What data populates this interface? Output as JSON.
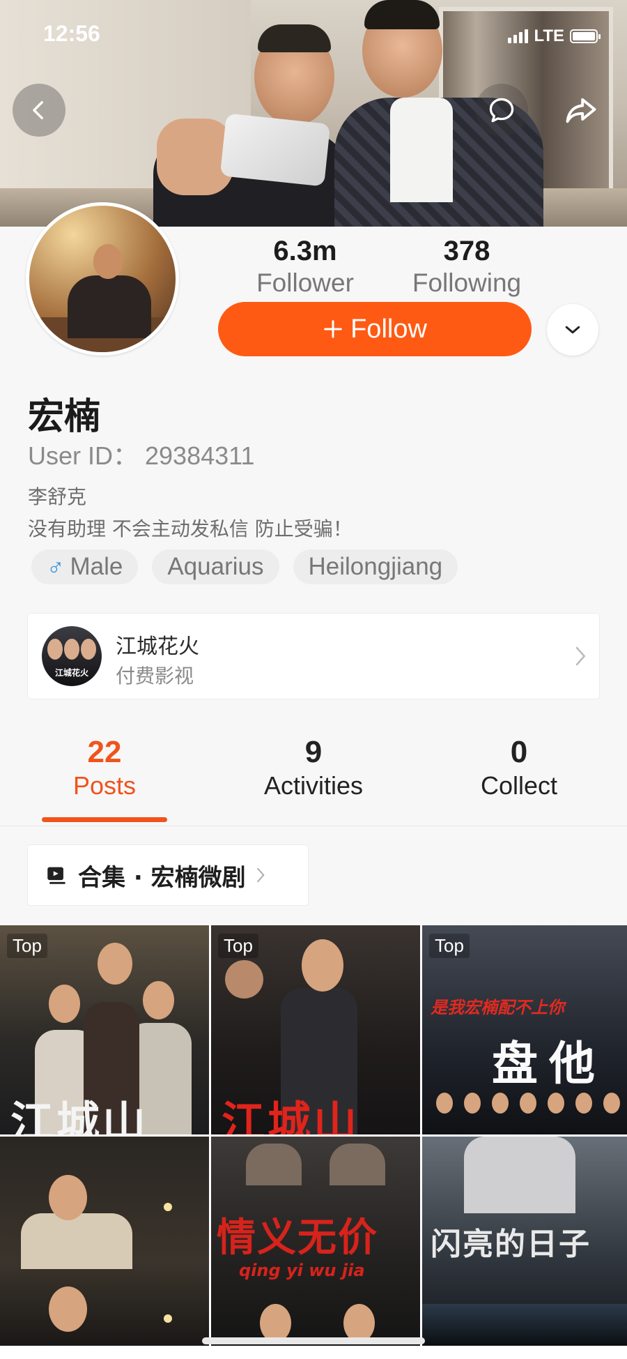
{
  "status_bar": {
    "time": "12:56",
    "network": "LTE"
  },
  "header": {
    "back_icon": "chevron-left-icon",
    "comment_icon": "comment-icon",
    "share_icon": "share-icon"
  },
  "profile": {
    "followers": "6.3m",
    "followers_label": "Follower",
    "following": "378",
    "following_label": "Following",
    "follow_button": "Follow",
    "name": "宏楠",
    "user_id": "User ID： 29384311",
    "bio_line1": "李舒克",
    "bio_line2": "没有助理 不会主动发私信 防止受骗！",
    "tags": [
      {
        "label": "Male",
        "icon": "male-icon"
      },
      {
        "label": "Aquarius"
      },
      {
        "label": "Heilongjiang"
      }
    ]
  },
  "drama_card": {
    "title": "江城花火",
    "subtitle": "付费影视",
    "thumb_text": "江城花火"
  },
  "tabs": [
    {
      "count": "22",
      "label": "Posts",
      "active": true
    },
    {
      "count": "9",
      "label": "Activities",
      "active": false
    },
    {
      "count": "0",
      "label": "Collect",
      "active": false
    }
  ],
  "collection": {
    "label": "合集 · 宏楠微剧"
  },
  "grid": {
    "badge": "Top",
    "items": [
      {
        "badge": "Top",
        "title": "江城山"
      },
      {
        "badge": "Top",
        "title": "江城山"
      },
      {
        "badge": "Top",
        "title": "是我宏楠配不上你",
        "title2": "盘他"
      },
      {
        "title": ""
      },
      {
        "title": "情义无价",
        "subtitle": "qing yi wu jia"
      },
      {
        "title": "闪亮的日子"
      }
    ]
  },
  "colors": {
    "accent": "#fe5a14",
    "tab_active": "#f0531c",
    "male": "#2d8fe4"
  }
}
